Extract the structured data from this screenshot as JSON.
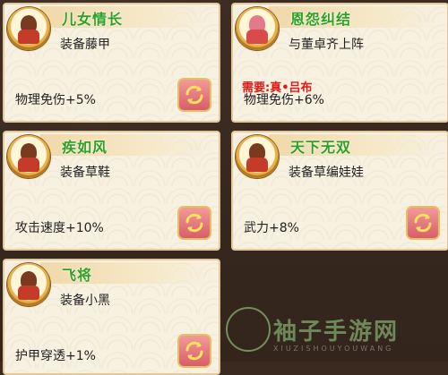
{
  "cards": [
    {
      "title": "儿女情长",
      "condition": "装备藤甲",
      "requirement": "",
      "effect": "物理免伤+5%",
      "avatar": "warrior-portrait"
    },
    {
      "title": "恩怨纠结",
      "condition": "与董卓齐上阵",
      "requirement": "需要:真•吕布",
      "effect": "物理免伤+6%",
      "avatar": "warrior-portrait"
    },
    {
      "title": "疾如风",
      "condition": "装备草鞋",
      "requirement": "",
      "effect": "攻击速度+10%",
      "avatar": "warrior-portrait"
    },
    {
      "title": "天下无双",
      "condition": "装备草编娃娃",
      "requirement": "",
      "effect": "武力+8%",
      "avatar": "warrior-portrait"
    },
    {
      "title": "飞将",
      "condition": "装备小黑",
      "requirement": "",
      "effect": "护甲穿透+1%",
      "avatar": "warrior-portrait"
    }
  ],
  "watermark": {
    "text": "袖子手游网",
    "sub": "XIUZISHOUYOUWANG"
  },
  "colors": {
    "title_green": "#2fa024",
    "requirement_red": "#e01818",
    "card_bg": "#f7f1e2",
    "button_pink": "#e07a80"
  }
}
